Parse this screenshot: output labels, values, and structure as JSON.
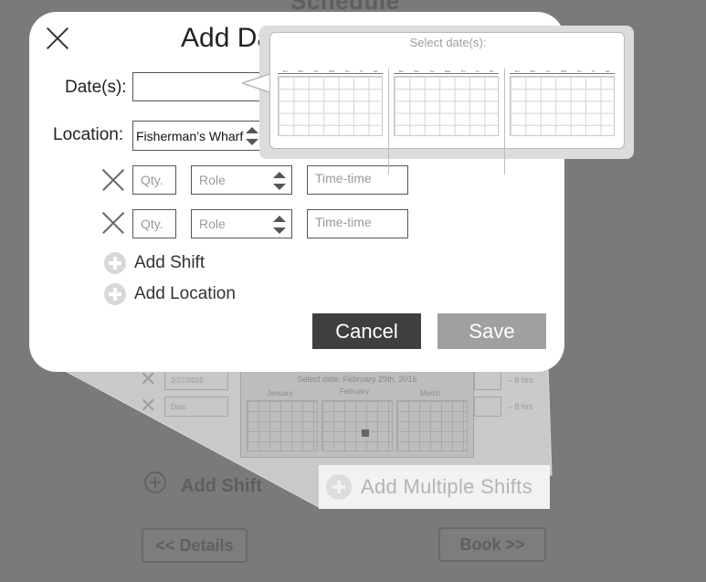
{
  "background": {
    "title": "Schedule",
    "add_shift_label": "Add Shift",
    "details_button": "<< Details",
    "book_button": "Book >>",
    "peek_calendar_header": "Select date: February 29th, 2016",
    "peek_months": [
      "January",
      "February",
      "March"
    ],
    "peek_row1_value": "2/27/2016",
    "peek_row2_value": "Date",
    "peek_hours": [
      "– 8 hrs",
      "– 8 hrs"
    ],
    "add_multiple_shifts_label": "Add Multiple Shifts"
  },
  "modal": {
    "title": "Add Date(s)",
    "dates_label": "Date(s):",
    "dates_value": "",
    "location_label": "Location:",
    "location_value": "Fisherman’s Wharf",
    "shifts": [
      {
        "qty_placeholder": "Qty.",
        "role_placeholder": "Role",
        "time_placeholder": "Time-time"
      },
      {
        "qty_placeholder": "Qty.",
        "role_placeholder": "Role",
        "time_placeholder": "Time-time"
      }
    ],
    "add_shift_label": "Add Shift",
    "add_location_label": "Add Location",
    "cancel_label": "Cancel",
    "save_label": "Save"
  },
  "date_picker": {
    "title": "Select date(s):",
    "weekday_headers": [
      "Sun",
      "Mon",
      "Tue",
      "Wed",
      "Thu",
      "Fri",
      "Sat"
    ],
    "calendar_count": 3
  }
}
